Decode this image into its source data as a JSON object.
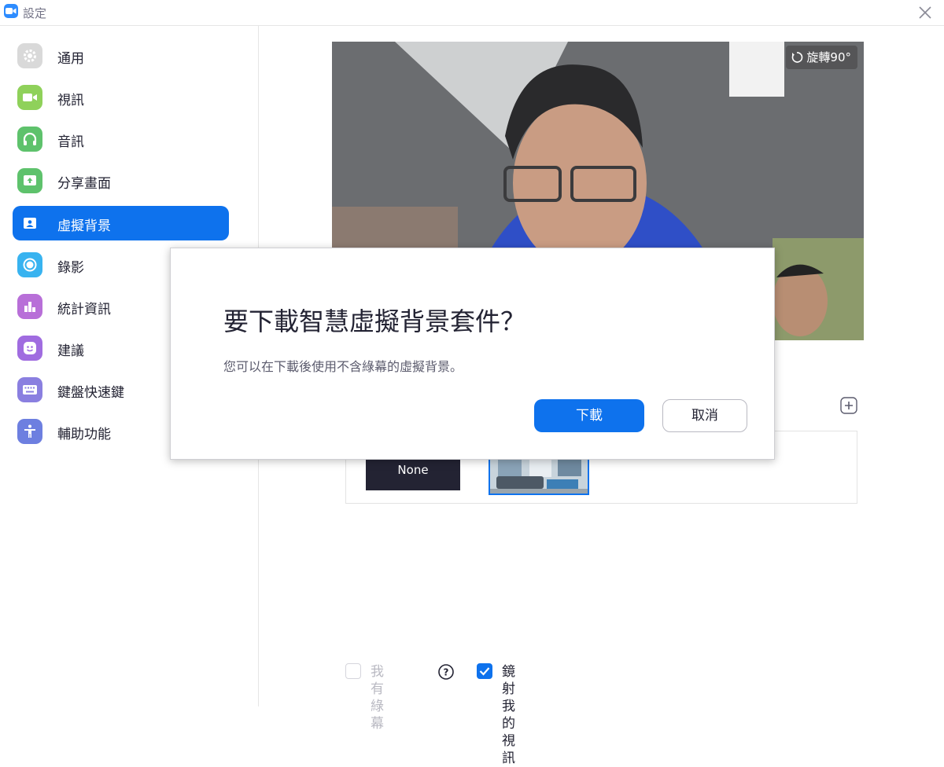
{
  "window": {
    "title": "設定"
  },
  "sidebar": {
    "items": [
      {
        "label": "通用",
        "icon": "gear-icon",
        "color": "#d9d9d9"
      },
      {
        "label": "視訊",
        "icon": "video-camera-icon",
        "color": "#8fd15a"
      },
      {
        "label": "音訊",
        "icon": "headphones-icon",
        "color": "#5ec26c"
      },
      {
        "label": "分享畫面",
        "icon": "share-screen-icon",
        "color": "#5ec26c"
      },
      {
        "label": "虛擬背景",
        "icon": "virtual-background-icon",
        "color": "#0E72ED",
        "active": true
      },
      {
        "label": "錄影",
        "icon": "record-icon",
        "color": "#38b3f0"
      },
      {
        "label": "統計資訊",
        "icon": "statistics-icon",
        "color": "#b86fd8"
      },
      {
        "label": "建議",
        "icon": "smiley-icon",
        "color": "#a06ce0"
      },
      {
        "label": "鍵盤快速鍵",
        "icon": "keyboard-icon",
        "color": "#8a7fe0"
      },
      {
        "label": "輔助功能",
        "icon": "accessibility-icon",
        "color": "#6d7fe0"
      }
    ]
  },
  "preview": {
    "rotate_label": "旋轉90°"
  },
  "backgrounds": {
    "none_label": "None"
  },
  "footer": {
    "green_screen_label": "我有綠幕",
    "green_screen_checked": false,
    "mirror_label": "鏡射我的視訊",
    "mirror_checked": true
  },
  "dialog": {
    "title": "要下載智慧虛擬背景套件？",
    "body": "您可以在下載後使用不含綠幕的虛擬背景。",
    "download_label": "下載",
    "cancel_label": "取消"
  },
  "colors": {
    "accent": "#0E72ED",
    "text": "#232333"
  }
}
